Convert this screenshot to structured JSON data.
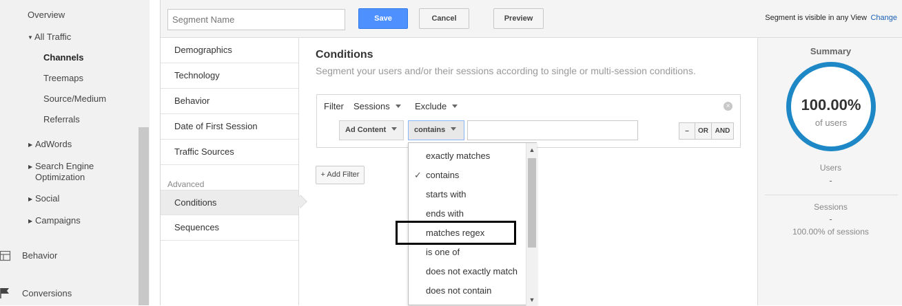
{
  "left_nav": {
    "items": [
      {
        "label": "Overview"
      },
      {
        "label": "All Traffic"
      },
      {
        "label": "Channels"
      },
      {
        "label": "Treemaps"
      },
      {
        "label": "Source/Medium"
      },
      {
        "label": "Referrals"
      },
      {
        "label": "AdWords"
      },
      {
        "label": "Search Engine"
      },
      {
        "label": "Optimization"
      },
      {
        "label": "Social"
      },
      {
        "label": "Campaigns"
      },
      {
        "label": "Behavior"
      },
      {
        "label": "Conversions"
      }
    ]
  },
  "topbar": {
    "segment_name_placeholder": "Segment Name",
    "save_label": "Save",
    "cancel_label": "Cancel",
    "preview_label": "Preview",
    "visibility_text": "Segment is visible in any View",
    "change_label": "Change"
  },
  "categories": {
    "items": [
      {
        "label": "Demographics"
      },
      {
        "label": "Technology"
      },
      {
        "label": "Behavior"
      },
      {
        "label": "Date of First Session"
      },
      {
        "label": "Traffic Sources"
      }
    ],
    "advanced_label": "Advanced",
    "advanced_items": [
      {
        "label": "Conditions"
      },
      {
        "label": "Sequences"
      }
    ]
  },
  "conditions": {
    "title": "Conditions",
    "subtitle": "Segment your users and/or their sessions according to single or multi-session conditions.",
    "filter_label": "Filter",
    "scope_value": "Sessions",
    "mode_value": "Exclude",
    "dimension_value": "Ad Content",
    "operator_value": "contains",
    "minus_label": "–",
    "or_label": "OR",
    "and_label": "AND",
    "add_filter_label": "+ Add Filter"
  },
  "operator_menu": {
    "items": [
      {
        "label": "exactly matches"
      },
      {
        "label": "contains",
        "checked_mark": "✓"
      },
      {
        "label": "starts with"
      },
      {
        "label": "ends with"
      },
      {
        "label": "matches regex"
      },
      {
        "label": "is one of"
      },
      {
        "label": "does not exactly match"
      },
      {
        "label": "does not contain"
      }
    ]
  },
  "summary": {
    "title": "Summary",
    "percent": "100.00%",
    "percent_sub": "of users",
    "users_label": "Users",
    "users_value": "-",
    "sessions_label": "Sessions",
    "sessions_value": "-",
    "sessions_sub": "100.00% of sessions",
    "ring_color": "#1e88c7"
  }
}
